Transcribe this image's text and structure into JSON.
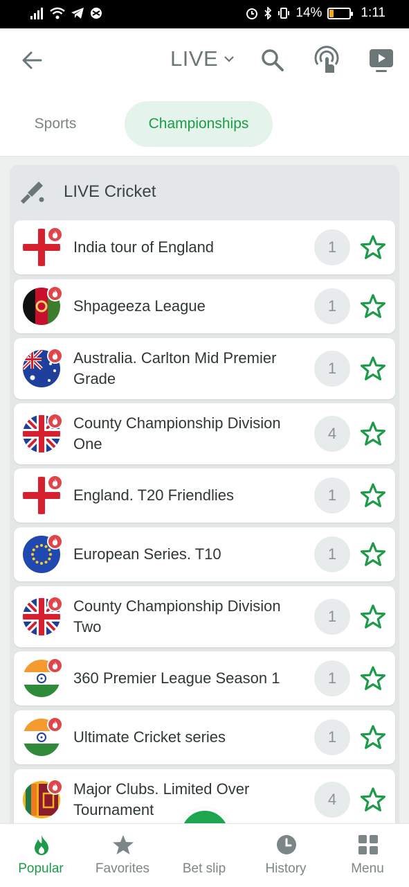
{
  "status_bar": {
    "battery": "14%",
    "time": "1:11"
  },
  "header": {
    "title": "LIVE"
  },
  "tabs": [
    {
      "label": "Sports",
      "active": false
    },
    {
      "label": "Championships",
      "active": true
    }
  ],
  "section": {
    "title": "LIVE Cricket"
  },
  "championships": [
    {
      "name": "India tour of England",
      "count": "1",
      "flag": "england"
    },
    {
      "name": "Shpageeza League",
      "count": "1",
      "flag": "afghanistan"
    },
    {
      "name": "Australia. Carlton Mid Premier Grade",
      "count": "1",
      "flag": "australia"
    },
    {
      "name": "County Championship Division One",
      "count": "4",
      "flag": "uk"
    },
    {
      "name": "England. T20 Friendlies",
      "count": "1",
      "flag": "england"
    },
    {
      "name": "European Series. T10",
      "count": "1",
      "flag": "eu"
    },
    {
      "name": "County Championship Division Two",
      "count": "1",
      "flag": "uk"
    },
    {
      "name": "360 Premier League Season 1",
      "count": "1",
      "flag": "india"
    },
    {
      "name": "Ultimate Cricket series",
      "count": "1",
      "flag": "india"
    },
    {
      "name": "Major Clubs. Limited Over Tournament",
      "count": "4",
      "flag": "sri-lanka"
    }
  ],
  "bottom_nav": [
    {
      "label": "Popular",
      "icon": "flame-icon",
      "active": true
    },
    {
      "label": "Favorites",
      "icon": "star-icon",
      "active": false
    },
    {
      "label": "Bet slip",
      "icon": "ticket-icon",
      "active": false
    },
    {
      "label": "History",
      "icon": "clock-icon",
      "active": false
    },
    {
      "label": "Menu",
      "icon": "grid-icon",
      "active": false
    }
  ],
  "colors": {
    "accent": "#1d9a4a",
    "accent_light": "#e4f4ea",
    "live_badge": "#e0454a"
  }
}
